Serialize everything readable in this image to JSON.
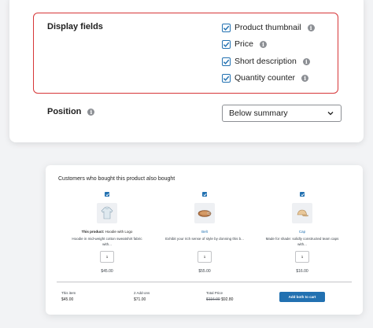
{
  "settings": {
    "display_fields_label": "Display fields",
    "fields": [
      {
        "label": "Product thumbnail",
        "checked": true
      },
      {
        "label": "Price",
        "checked": true
      },
      {
        "label": "Short description",
        "checked": true
      },
      {
        "label": "Quantity counter",
        "checked": true
      }
    ],
    "position_label": "Position",
    "position_value": "Below summary",
    "info_glyph": "i",
    "accent_color": "#2271b1",
    "highlight_color": "#d63638"
  },
  "preview": {
    "heading": "Customers who bought this product also bought",
    "products": [
      {
        "title_prefix": "This product:",
        "title": "Hoodie with Logo",
        "description": [
          "Hoodie in mid-weight cotton sweatshirt fabric",
          "with..."
        ],
        "quantity": "1",
        "price": "$45.00",
        "thumbnail_icon": "hoodie-icon"
      },
      {
        "title_prefix": "",
        "title": "Belt",
        "description": [
          "Exhibit your rich sense of style by donning this b..."
        ],
        "quantity": "1",
        "price": "$55.00",
        "thumbnail_icon": "belt-icon"
      },
      {
        "title_prefix": "",
        "title": "Cap",
        "description": [
          "Made for shade: solidly constructed team caps",
          "with..."
        ],
        "quantity": "1",
        "price": "$16.00",
        "thumbnail_icon": "cap-icon"
      }
    ],
    "summary": {
      "this_item_label": "This item",
      "this_item_value": "$45.00",
      "addons_label": "2 Add-ons",
      "addons_value": "$71.00",
      "total_label": "Total Price",
      "total_old": "$116.00",
      "total_new": "$92.80",
      "button_label": "Add both to cart"
    }
  }
}
